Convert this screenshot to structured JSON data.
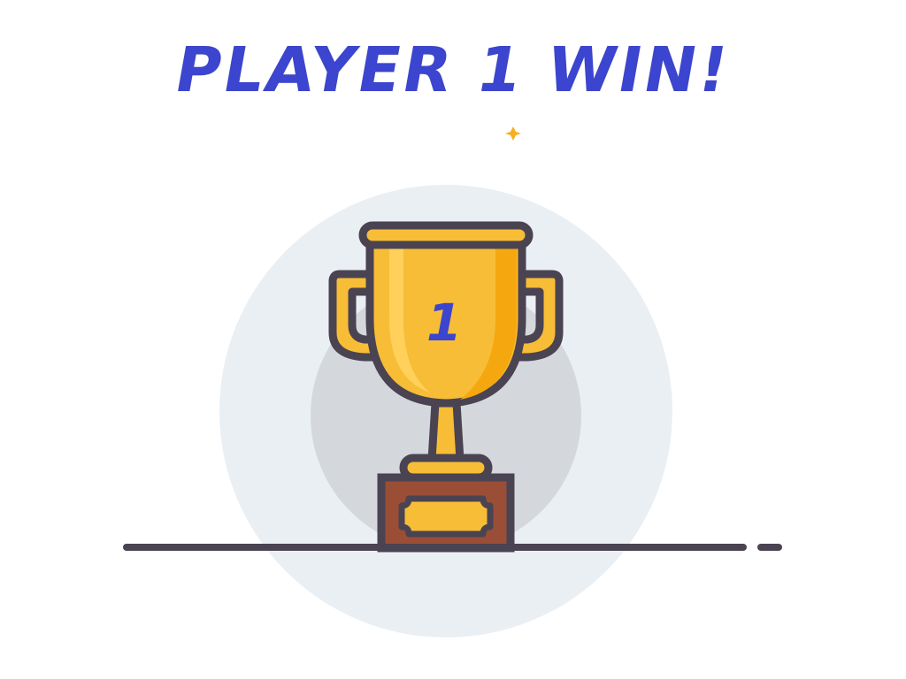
{
  "screen": {
    "title": "PLAYER 1 WIN!"
  },
  "trophy": {
    "rank": "1",
    "icon": "trophy-icon"
  },
  "colors": {
    "title": "#3b45cf",
    "rank": "#3b45cf",
    "cup": "#f7bd36",
    "cup_shadow": "#f5a70f",
    "cup_light": "#ffd25e",
    "outline": "#4a4352",
    "base": "#9b4e36",
    "sparkle": "#f5b020",
    "outer_circle": "#eaeff3",
    "inner_circle": "#d4d8dc"
  }
}
